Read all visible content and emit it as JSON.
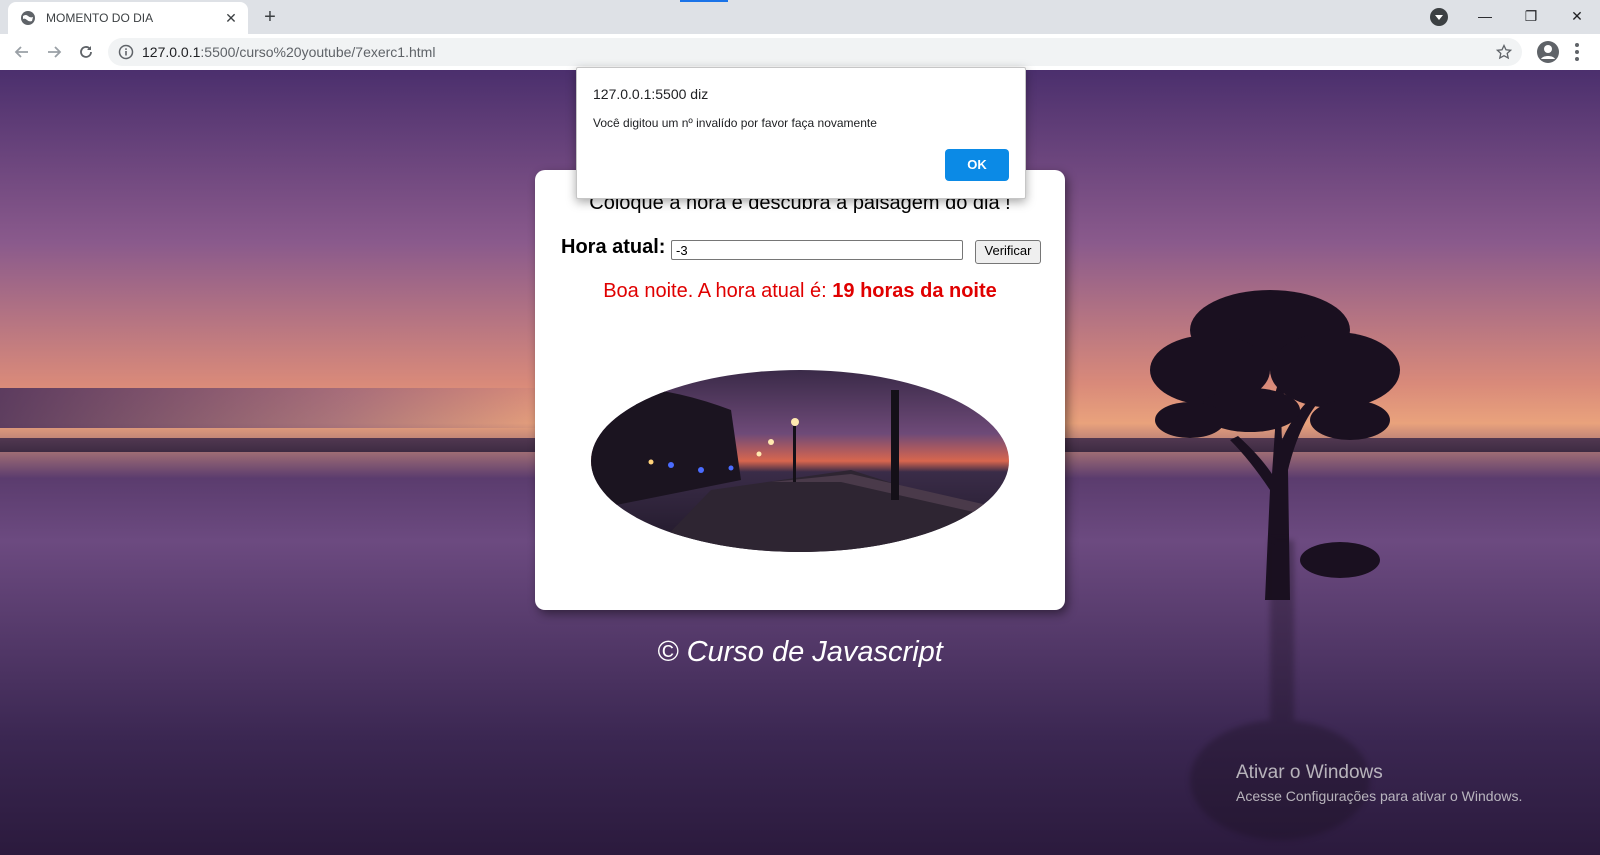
{
  "browser": {
    "tab_title": "MOMENTO DO DIA",
    "tab_close": "✕",
    "new_tab": "+",
    "url_host": "127.0.0.1",
    "url_rest": ":5500/curso%20youtube/7exerc1.html",
    "window_controls": [
      "—",
      "❐",
      "✕"
    ]
  },
  "page": {
    "heading": "Coloque a hora e descubra a paisagem do dia !",
    "hour_label": "Hora atual:",
    "hour_value": "-3",
    "verify_label": "Verificar",
    "result_text": "Boa noite. A hora atual é: ",
    "result_hour": "19 horas da noite",
    "footer": "© Curso de Javascript"
  },
  "alert": {
    "origin": "127.0.0.1:5500 diz",
    "message": "Você digitou um nº invalído por favor faça novamente",
    "ok_label": "OK"
  },
  "windows_notice": {
    "title": "Ativar o Windows",
    "subtitle": "Acesse Configurações para ativar o Windows."
  },
  "colors": {
    "result_red": "#e00000",
    "ok_blue": "#0b8ae6"
  }
}
